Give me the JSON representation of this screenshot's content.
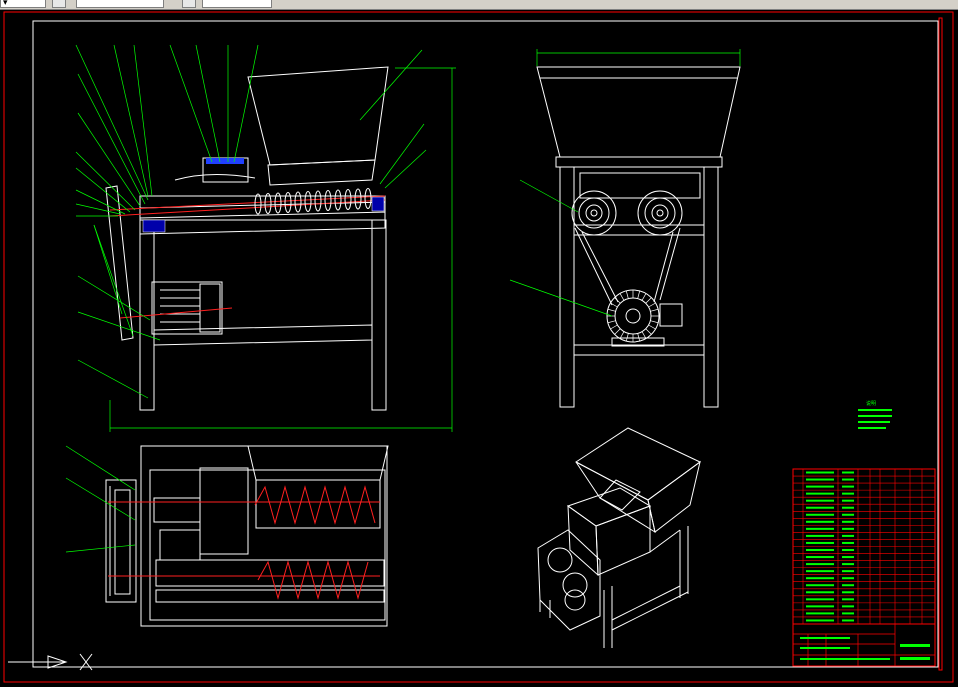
{
  "toolbar": {
    "field1": "▾",
    "field2": "",
    "field3": ""
  },
  "colors": {
    "background": "#000000",
    "sheet_frame": "#ff0000",
    "border": "#ffffff",
    "leader": "#00ff00",
    "auger": "#ff2020",
    "block": "#0000ff"
  },
  "notes": {
    "heading": "说明",
    "lines": [
      "",
      "",
      "",
      ""
    ]
  },
  "title_block": {
    "name": "",
    "code": ""
  }
}
